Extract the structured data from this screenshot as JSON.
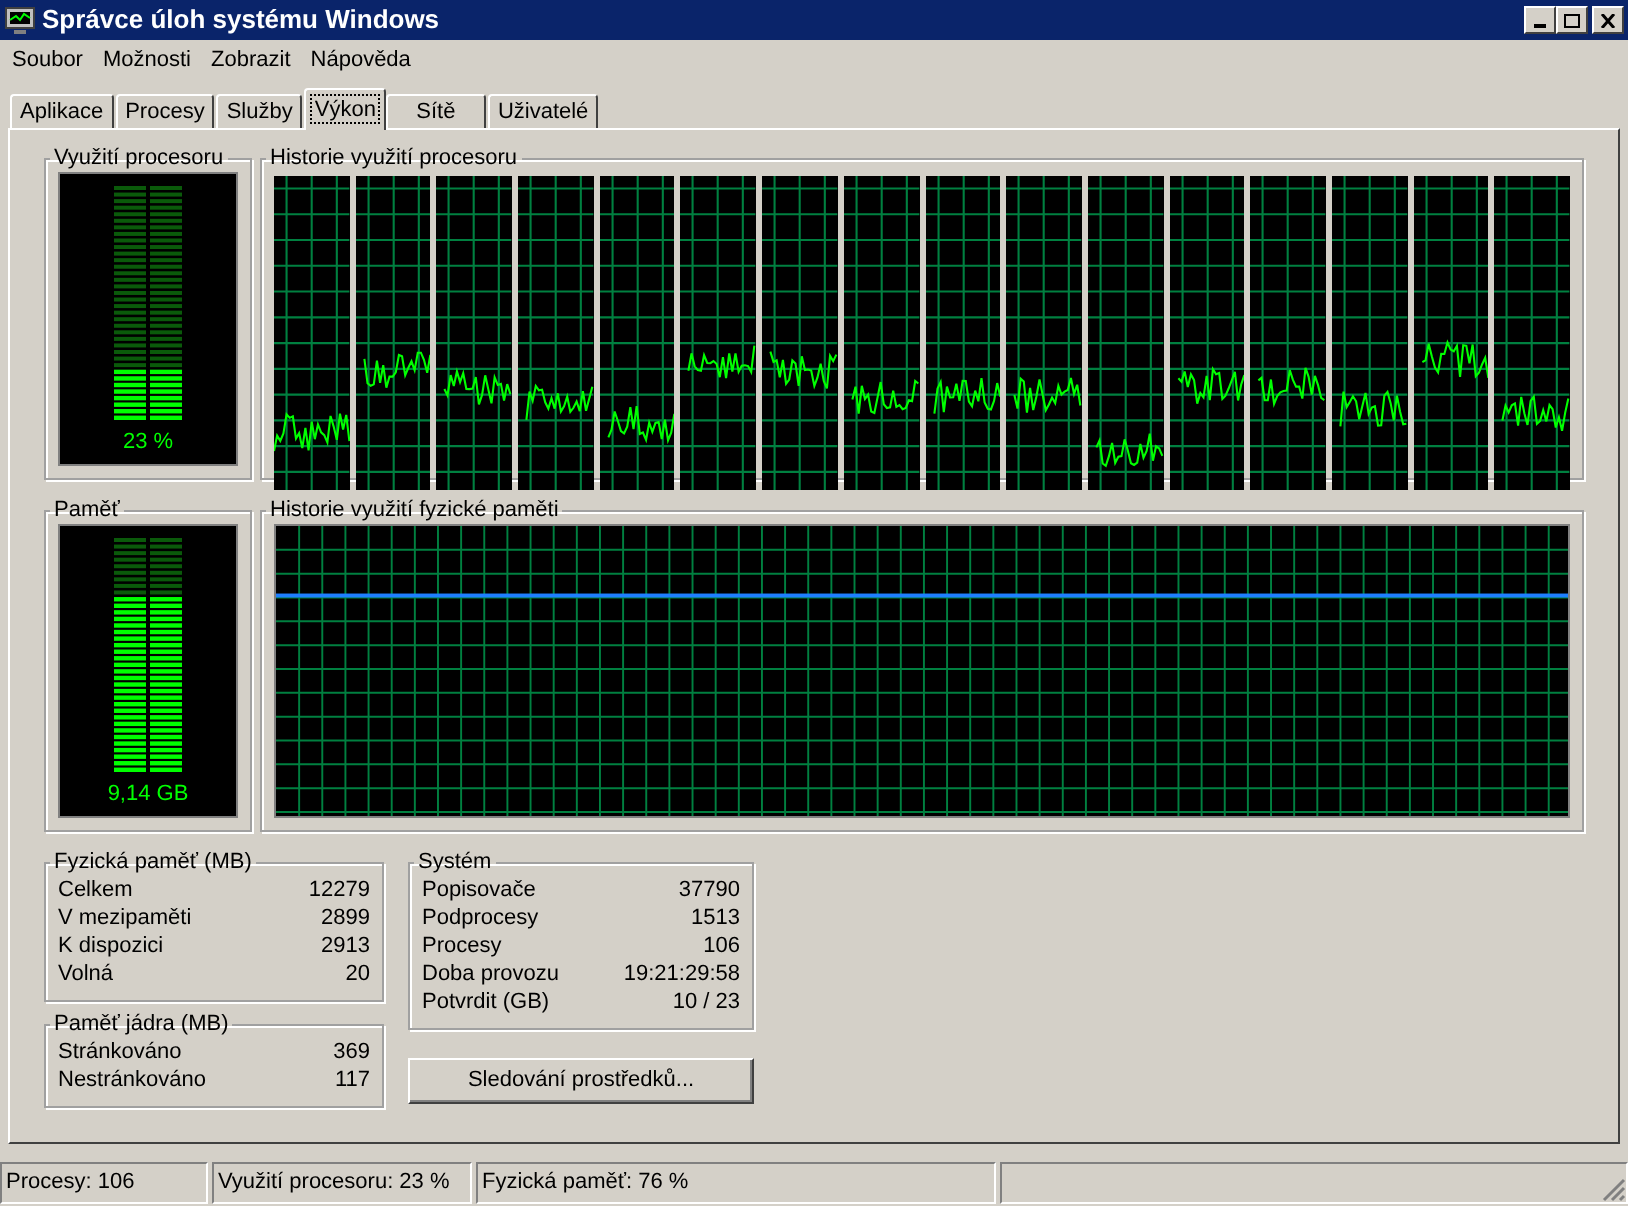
{
  "window": {
    "title": "Správce úloh systému Windows"
  },
  "menu": [
    "Soubor",
    "Možnosti",
    "Zobrazit",
    "Nápověda"
  ],
  "tabs": [
    {
      "label": "Aplikace",
      "selected": false
    },
    {
      "label": "Procesy",
      "selected": false
    },
    {
      "label": "Služby",
      "selected": false
    },
    {
      "label": "Výkon",
      "selected": true
    },
    {
      "label": "Sítě",
      "selected": false
    },
    {
      "label": "Uživatelé",
      "selected": false
    }
  ],
  "cpu_usage": {
    "title": "Využití procesoru",
    "reading": "23 %",
    "level": 0.23
  },
  "cpu_history": {
    "title": "Historie využití procesoru"
  },
  "memory": {
    "title": "Paměť",
    "reading": "9,14 GB",
    "level": 0.76
  },
  "memory_history": {
    "title": "Historie využití fyzické paměti"
  },
  "physical_memory": {
    "title": "Fyzická paměť (MB)",
    "rows": [
      {
        "label": "Celkem",
        "value": "12279"
      },
      {
        "label": "V mezipaměti",
        "value": "2899"
      },
      {
        "label": "K dispozici",
        "value": "2913"
      },
      {
        "label": "Volná",
        "value": "20"
      }
    ]
  },
  "kernel_memory": {
    "title": "Paměť jádra (MB)",
    "rows": [
      {
        "label": "Stránkováno",
        "value": "369"
      },
      {
        "label": "Nestránkováno",
        "value": "117"
      }
    ]
  },
  "system": {
    "title": "Systém",
    "rows": [
      {
        "label": "Popisovače",
        "value": "37790"
      },
      {
        "label": "Podprocesy",
        "value": "1513"
      },
      {
        "label": "Procesy",
        "value": "106"
      },
      {
        "label": "Doba provozu",
        "value": "19:21:29:58"
      },
      {
        "label": "Potvrdit (GB)",
        "value": "10 / 23"
      }
    ]
  },
  "button": "Sledování prostředků...",
  "status_bar": [
    "Procesy: 106",
    "Využití procesoru: 23 %",
    "Fyzická paměť: 76 %"
  ]
}
